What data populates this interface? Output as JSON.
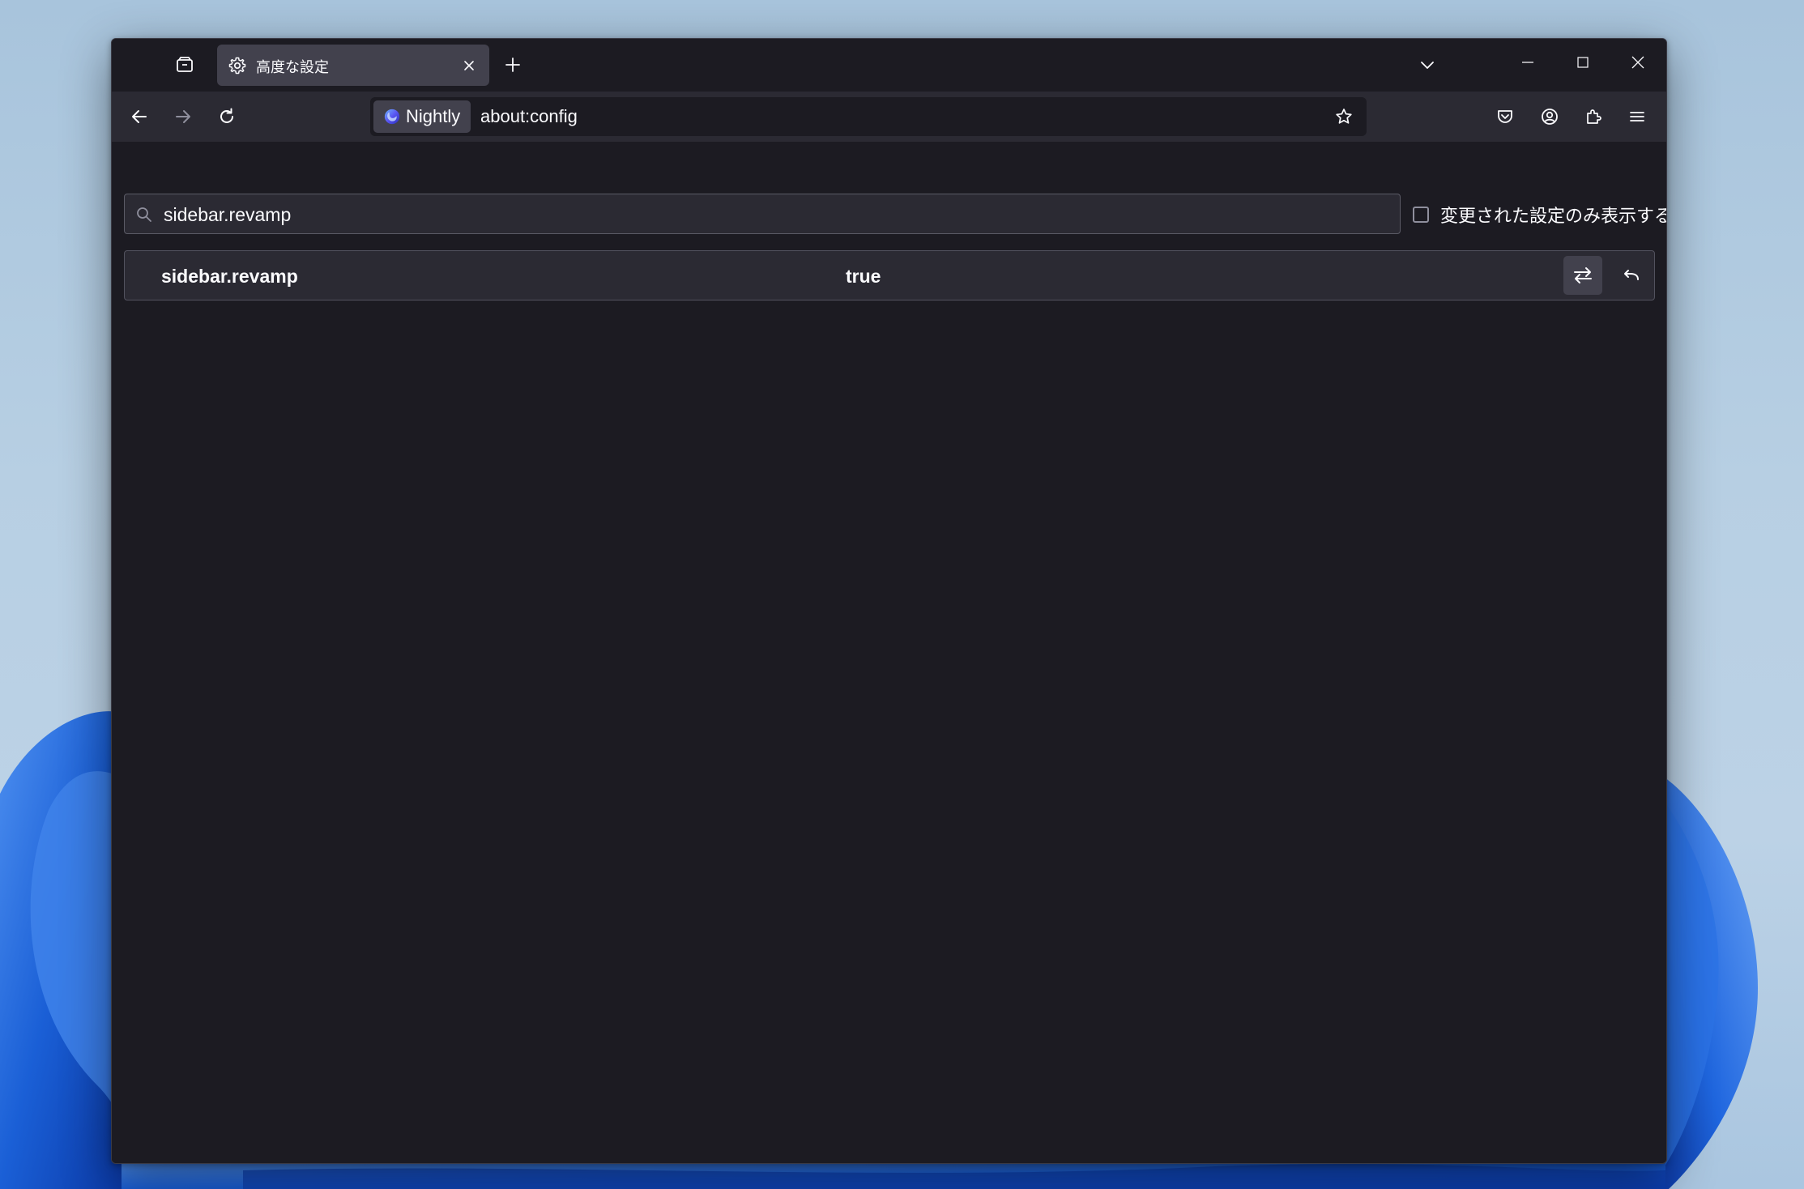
{
  "tabs": [
    {
      "label": "高度な設定",
      "icon": "gear-icon",
      "active": true
    }
  ],
  "toolbar": {
    "identity_label": "Nightly",
    "url": "about:config"
  },
  "config": {
    "search_value": "sidebar.revamp",
    "modified_only_label": "変更された設定のみ表示する",
    "modified_only_checked": false,
    "prefs": [
      {
        "name": "sidebar.revamp",
        "value": "true"
      }
    ]
  },
  "colors": {
    "window_bg": "#1c1b22",
    "toolbar_bg": "#2b2a33",
    "tab_active_bg": "#42414d",
    "text": "#fbfbfe",
    "desktop_bg": "#b7cfe3",
    "bloom_blue": "#1a5fd6"
  }
}
